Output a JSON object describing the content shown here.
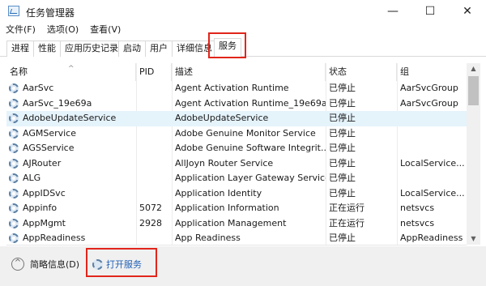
{
  "window": {
    "title": "任务管理器",
    "minimize_glyph": "—",
    "maximize_glyph": "☐",
    "close_glyph": "✕"
  },
  "menu": [
    "文件(F)",
    "选项(O)",
    "查看(V)"
  ],
  "tabs": [
    "进程",
    "性能",
    "应用历史记录",
    "启动",
    "用户",
    "详细信息",
    "服务"
  ],
  "active_tab": "服务",
  "columns": {
    "name": "名称",
    "pid": "PID",
    "desc": "描述",
    "status": "状态",
    "group": "组"
  },
  "sort_indicator": "^",
  "services": [
    {
      "name": "AarSvc",
      "pid": "",
      "desc": "Agent Activation Runtime",
      "status": "已停止",
      "group": "AarSvcGroup"
    },
    {
      "name": "AarSvc_19e69a",
      "pid": "",
      "desc": "Agent Activation Runtime_19e69a",
      "status": "已停止",
      "group": "AarSvcGroup"
    },
    {
      "name": "AdobeUpdateService",
      "pid": "",
      "desc": "AdobeUpdateService",
      "status": "已停止",
      "group": ""
    },
    {
      "name": "AGMService",
      "pid": "",
      "desc": "Adobe Genuine Monitor Service",
      "status": "已停止",
      "group": ""
    },
    {
      "name": "AGSService",
      "pid": "",
      "desc": "Adobe Genuine Software Integrit...",
      "status": "已停止",
      "group": ""
    },
    {
      "name": "AJRouter",
      "pid": "",
      "desc": "AllJoyn Router Service",
      "status": "已停止",
      "group": "LocalService..."
    },
    {
      "name": "ALG",
      "pid": "",
      "desc": "Application Layer Gateway Service",
      "status": "已停止",
      "group": ""
    },
    {
      "name": "AppIDSvc",
      "pid": "",
      "desc": "Application Identity",
      "status": "已停止",
      "group": "LocalService..."
    },
    {
      "name": "Appinfo",
      "pid": "5072",
      "desc": "Application Information",
      "status": "正在运行",
      "group": "netsvcs"
    },
    {
      "name": "AppMgmt",
      "pid": "2928",
      "desc": "Application Management",
      "status": "正在运行",
      "group": "netsvcs"
    },
    {
      "name": "AppReadiness",
      "pid": "",
      "desc": "App Readiness",
      "status": "已停止",
      "group": "AppReadiness"
    }
  ],
  "selected_row": 2,
  "footer": {
    "collapse_glyph": "^",
    "brief_label": "简略信息(D)",
    "open_services_label": "打开服务"
  },
  "colors": {
    "highlight_box": "#e1251b",
    "selected_row": "#e5f3fb",
    "link": "#1f5fb5"
  }
}
